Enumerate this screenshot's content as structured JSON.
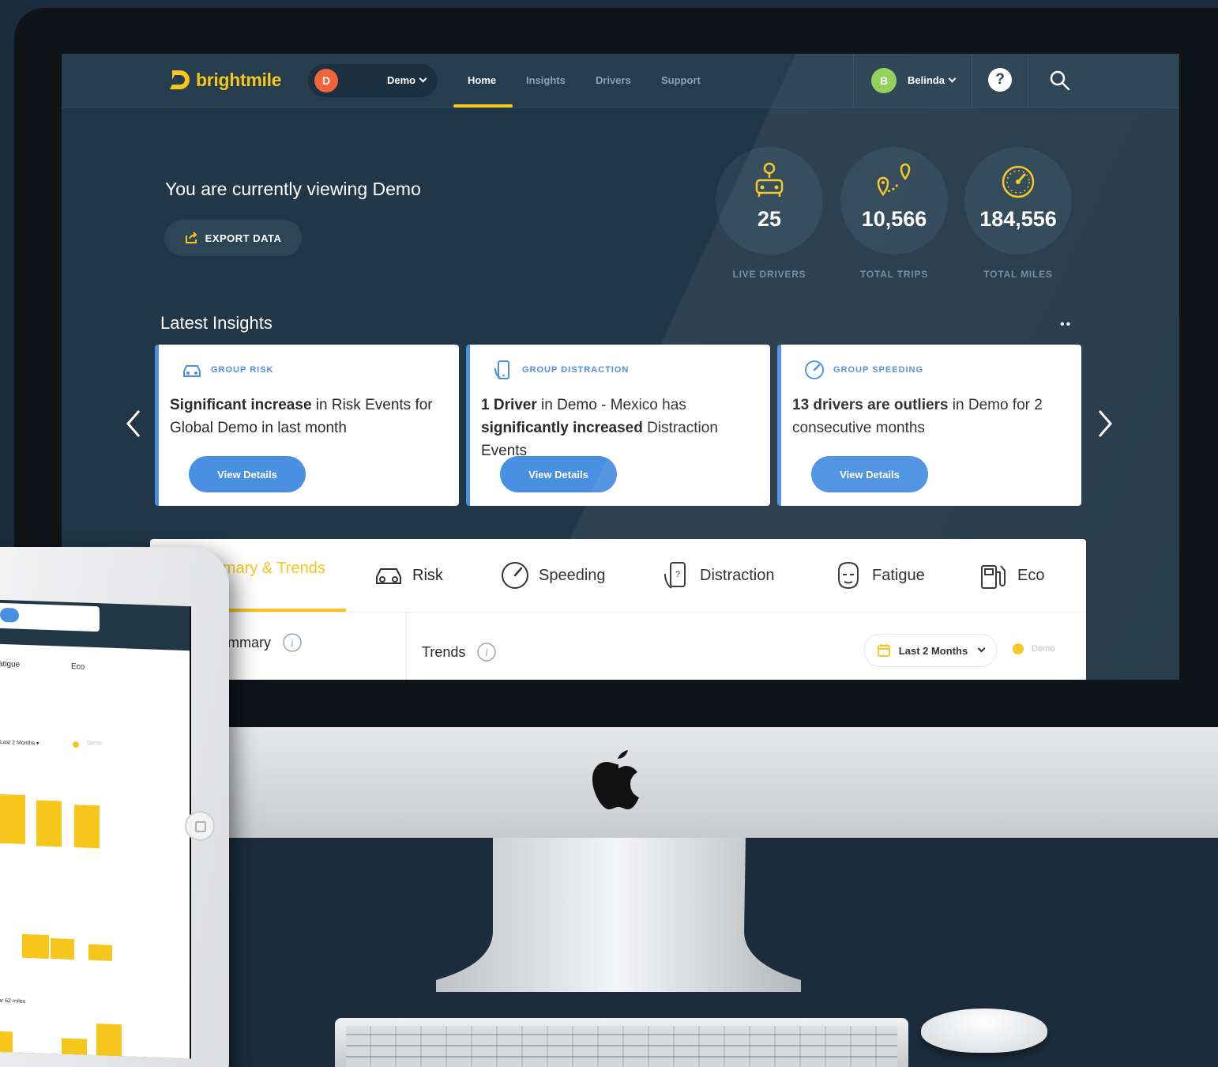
{
  "app": {
    "logo_text": "brightmile",
    "org_initial": "D",
    "org_name": "Demo",
    "nav": [
      "Home",
      "Insights",
      "Drivers",
      "Support"
    ],
    "active_nav": "Home",
    "user_initial": "B",
    "user_name": "Belinda",
    "help_symbol": "?",
    "brand_color": "#f7c61d",
    "accent_color": "#4a90e2"
  },
  "hero": {
    "title": "You are currently viewing Demo",
    "export_label": "EXPORT DATA",
    "stats": [
      {
        "value": "25",
        "label": "LIVE DRIVERS",
        "icon": "driver-location-icon"
      },
      {
        "value": "10,566",
        "label": "TOTAL TRIPS",
        "icon": "route-icon"
      },
      {
        "value": "184,556",
        "label": "TOTAL MILES",
        "icon": "speedometer-icon"
      }
    ]
  },
  "insights": {
    "title": "Latest Insights",
    "more": "••",
    "cards": [
      {
        "tag": "GROUP RISK",
        "icon": "car-icon",
        "bold1": "Significant increase",
        "text1": " in Risk Events for Global Demo in last month",
        "bold2": "",
        "text2": "",
        "button": "View Details"
      },
      {
        "tag": "GROUP DISTRACTION",
        "icon": "phone-icon",
        "bold1": "1 Driver",
        "text1": " in Demo - Mexico has ",
        "bold2": "significantly increased",
        "text2": " Distraction Events",
        "button": "View Details"
      },
      {
        "tag": "GROUP SPEEDING",
        "icon": "speed-icon",
        "bold1": "13 drivers are outliers",
        "text1": " in Demo for 2 consecutive months",
        "bold2": "",
        "text2": "",
        "button": "View Details"
      }
    ]
  },
  "tabs": [
    {
      "label": "ummary & Trends",
      "icon": ""
    },
    {
      "label": "Risk",
      "icon": "car-icon"
    },
    {
      "label": "Speeding",
      "icon": "speedometer-icon"
    },
    {
      "label": "Distraction",
      "icon": "phone-hand-icon"
    },
    {
      "label": "Fatigue",
      "icon": "tired-face-icon"
    },
    {
      "label": "Eco",
      "icon": "fuel-pump-icon"
    }
  ],
  "panel": {
    "summary_label": "Summary",
    "trends_label": "Trends",
    "period": "Last 2 Months",
    "legend": "Demo"
  },
  "ipad": {
    "tab_fatigue": "atigue",
    "tab_eco": "Eco",
    "period": "Last 2 Months ▾",
    "legend": "Demo",
    "chart_label": "ar 62 miles"
  }
}
